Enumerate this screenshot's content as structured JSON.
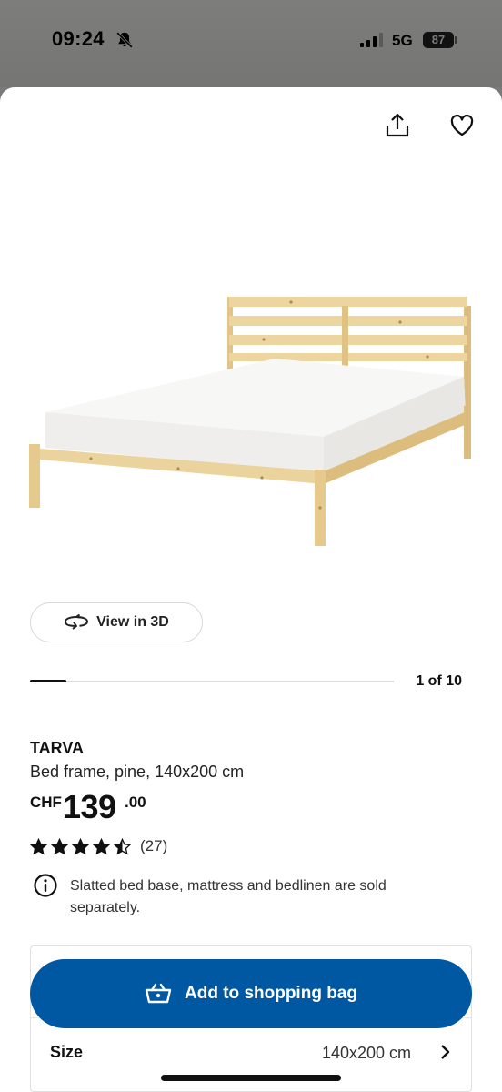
{
  "status_bar": {
    "time": "09:24",
    "network": "5G",
    "battery": "87"
  },
  "gallery": {
    "view_3d_label": "View in 3D",
    "counter": "1 of 10",
    "progress_fraction": 0.1
  },
  "product": {
    "name": "TARVA",
    "description": "Bed frame, pine, 140x200 cm",
    "price": {
      "currency": "CHF",
      "integer": "139",
      "decimals": ".00"
    },
    "rating": {
      "stars": 4.5,
      "count": "(27)"
    },
    "notice": "Slatted bed base, mattress and bedlinen are sold separately."
  },
  "actions": {
    "add_to_bag_label": "Add to shopping bag"
  },
  "size": {
    "label": "Size",
    "value": "140x200 cm"
  },
  "colors": {
    "brand_blue": "#0058a3",
    "pine": "#e8cf94",
    "mattress": "#f7f7f5"
  },
  "icons": {
    "share": "share-icon",
    "favourite": "heart-icon",
    "view_3d": "rotate-icon",
    "info": "info-icon",
    "bag": "shopping-basket-icon",
    "chevron": "chevron-right-icon"
  }
}
